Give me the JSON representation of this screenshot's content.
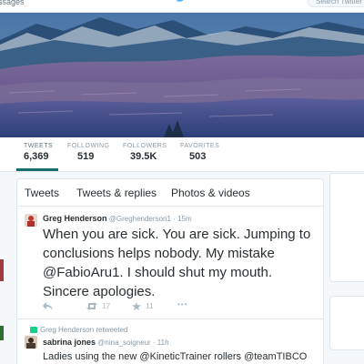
{
  "topnav": {
    "messages_label": "ssages",
    "bird_icon": "twitter-bird-icon",
    "search_placeholder": "Search Twitter"
  },
  "profile_nav": {
    "stats": [
      {
        "label": "TWEETS",
        "value": "6,369"
      },
      {
        "label": "FOLLOWING",
        "value": "519"
      },
      {
        "label": "FOLLOWERS",
        "value": "39.5K"
      },
      {
        "label": "FAVORITES",
        "value": "503"
      }
    ],
    "active_color": "#1a6c6a"
  },
  "timeline": {
    "tabs": [
      "Tweets",
      "Tweets & replies",
      "Photos & videos"
    ],
    "tweets": [
      {
        "name": "Greg Henderson",
        "handle": "@Greghenderson1",
        "separator": "·",
        "time": "15m",
        "text": "When you are sick. You are sick. Jumping to conclusions helps nobody. My mistake @FabioAru1. I should shut my mouth. Sincere apologies.",
        "retweets": "17",
        "favorites": "11",
        "more": "•••"
      },
      {
        "retweeted_by": "Greg Henderson retweeted",
        "name": "sabrina jones",
        "handle": "@nina_soigneur",
        "separator": "·",
        "time": "11h",
        "text": "Ladies using the new @KineticTrainer rollers @teamTIBCO"
      }
    ]
  },
  "colors": {
    "retweet_green": "#19cf86",
    "text": "#292f33",
    "muted": "#8899a6"
  }
}
